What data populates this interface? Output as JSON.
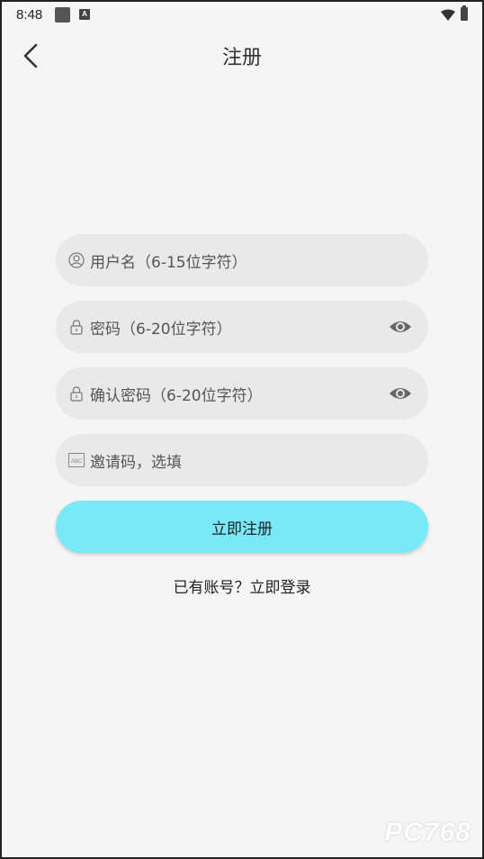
{
  "status_bar": {
    "time": "8:48",
    "icons": [
      "notification-square-icon",
      "a-notification-icon",
      "wifi-icon",
      "battery-icon"
    ]
  },
  "header": {
    "title": "注册",
    "back_icon": "chevron-left-icon"
  },
  "form": {
    "username": {
      "placeholder": "用户名（6-15位字符）",
      "icon": "user-icon"
    },
    "password": {
      "placeholder": "密码（6-20位字符）",
      "icon": "lock-icon",
      "toggle_icon": "eye-icon"
    },
    "confirm_password": {
      "placeholder": "确认密码（6-20位字符）",
      "icon": "lock-icon",
      "toggle_icon": "eye-icon"
    },
    "invite_code": {
      "placeholder": "邀请码，选填",
      "icon": "abc-keyboard-icon"
    },
    "submit_label": "立即注册"
  },
  "login_link": "已有账号？立即登录",
  "watermark": "PC768",
  "colors": {
    "background": "#f5f5f5",
    "field_bg": "#e9e9e9",
    "button_bg": "#7ae9f7"
  }
}
